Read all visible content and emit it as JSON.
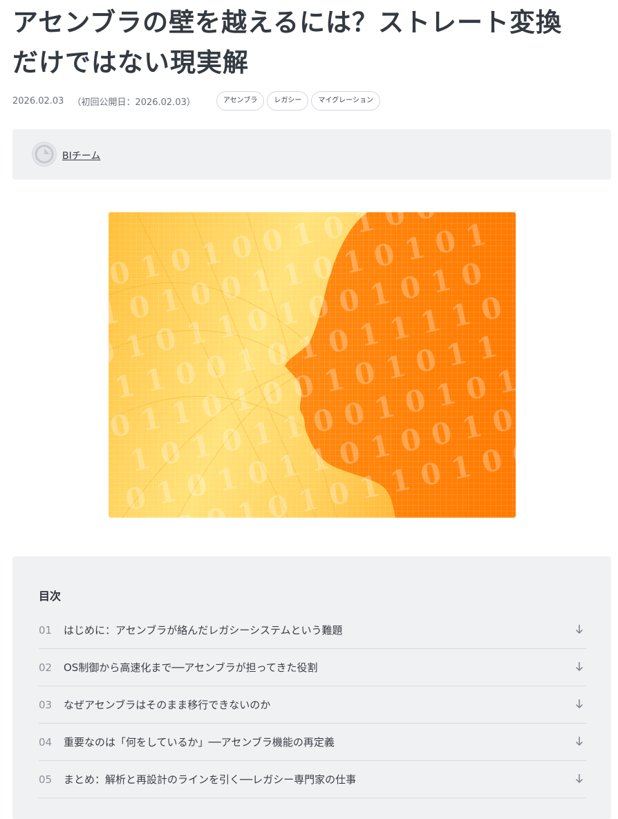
{
  "article": {
    "title_line1": "アセンブラの壁を越えるには？ストレート変換",
    "title_line2": "だけではない現実解",
    "date": "2026.02.03",
    "published": "（初回公開日：2026.02.03）",
    "tags": [
      "アセンブラ",
      "レガシー",
      "マイグレーション"
    ]
  },
  "author": {
    "name": "BIチーム"
  },
  "hero": {
    "bits": [
      "0010100101",
      "1010011010",
      "0101101001",
      "1100101011",
      "0110100101",
      "1010110010",
      "0101011010",
      "1001010110"
    ],
    "colors": {
      "light": "#ffd36a",
      "dark": "#ff7f00"
    }
  },
  "toc": {
    "title": "目次",
    "items": [
      {
        "num": "01",
        "label": "はじめに：アセンブラが絡んだレガシーシステムという難題"
      },
      {
        "num": "02",
        "label": "OS制御から高速化まで──アセンブラが担ってきた役割"
      },
      {
        "num": "03",
        "label": "なぜアセンブラはそのまま移行できないのか"
      },
      {
        "num": "04",
        "label": "重要なのは「何をしているか」──アセンブラ機能の再定義"
      },
      {
        "num": "05",
        "label": "まとめ：解析と再設計のラインを引く──レガシー専門家の仕事"
      }
    ]
  }
}
